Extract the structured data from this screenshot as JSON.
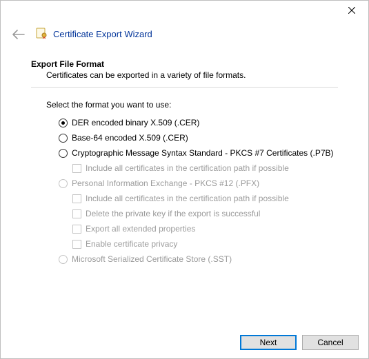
{
  "window": {
    "title": "Certificate Export Wizard",
    "close_tooltip": "Close"
  },
  "page": {
    "heading": "Export File Format",
    "subheading": "Certificates can be exported in a variety of file formats.",
    "prompt": "Select the format you want to use:"
  },
  "options": {
    "der": {
      "label": "DER encoded binary X.509 (.CER)",
      "selected": true,
      "enabled": true
    },
    "b64": {
      "label": "Base-64 encoded X.509 (.CER)",
      "selected": false,
      "enabled": true
    },
    "p7b": {
      "label": "Cryptographic Message Syntax Standard - PKCS #7 Certificates (.P7B)",
      "selected": false,
      "enabled": true,
      "sub": {
        "include_chain": {
          "label": "Include all certificates in the certification path if possible",
          "enabled": false
        }
      }
    },
    "pfx": {
      "label": "Personal Information Exchange - PKCS #12 (.PFX)",
      "selected": false,
      "enabled": false,
      "sub": {
        "include_chain": {
          "label": "Include all certificates in the certification path if possible",
          "enabled": false
        },
        "delete_key": {
          "label": "Delete the private key if the export is successful",
          "enabled": false
        },
        "ext_props": {
          "label": "Export all extended properties",
          "enabled": false
        },
        "cert_privacy": {
          "label": "Enable certificate privacy",
          "enabled": false
        }
      }
    },
    "sst": {
      "label": "Microsoft Serialized Certificate Store (.SST)",
      "selected": false,
      "enabled": false
    }
  },
  "buttons": {
    "next": "Next",
    "cancel": "Cancel"
  }
}
